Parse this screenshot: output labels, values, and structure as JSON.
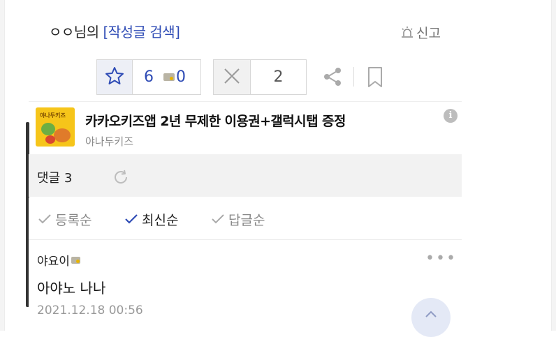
{
  "header": {
    "author_name": "ㅇㅇ님의",
    "search_link": "[작성글 검색]",
    "report_label": "신고"
  },
  "actions": {
    "like_count": "6",
    "coin_count": "0",
    "dislike_count": "2"
  },
  "ad": {
    "thumb_brand": "야나두키즈",
    "title": "카카오키즈앱 2년 무제한 이용권+갤럭시탭 증정",
    "sponsor": "야나두키즈",
    "info_label": "i"
  },
  "comments": {
    "header_label": "댓글 3",
    "sort_options": [
      {
        "label": "등록순",
        "active": false
      },
      {
        "label": "최신순",
        "active": true
      },
      {
        "label": "답글순",
        "active": false
      }
    ],
    "items": [
      {
        "author": "야요이",
        "text": "아야노 나나",
        "date": "2021.12.18 00:56",
        "more": "•••"
      }
    ]
  },
  "colors": {
    "link_blue": "#2e4bb5",
    "muted": "#888888",
    "panel_gray": "#f2f2f2"
  },
  "icons": [
    "siren-icon",
    "star-icon",
    "coin-icon",
    "close-x-icon",
    "share-icon",
    "bookmark-icon",
    "info-icon",
    "refresh-icon",
    "check-icon",
    "more-icon",
    "chevron-up-icon"
  ]
}
